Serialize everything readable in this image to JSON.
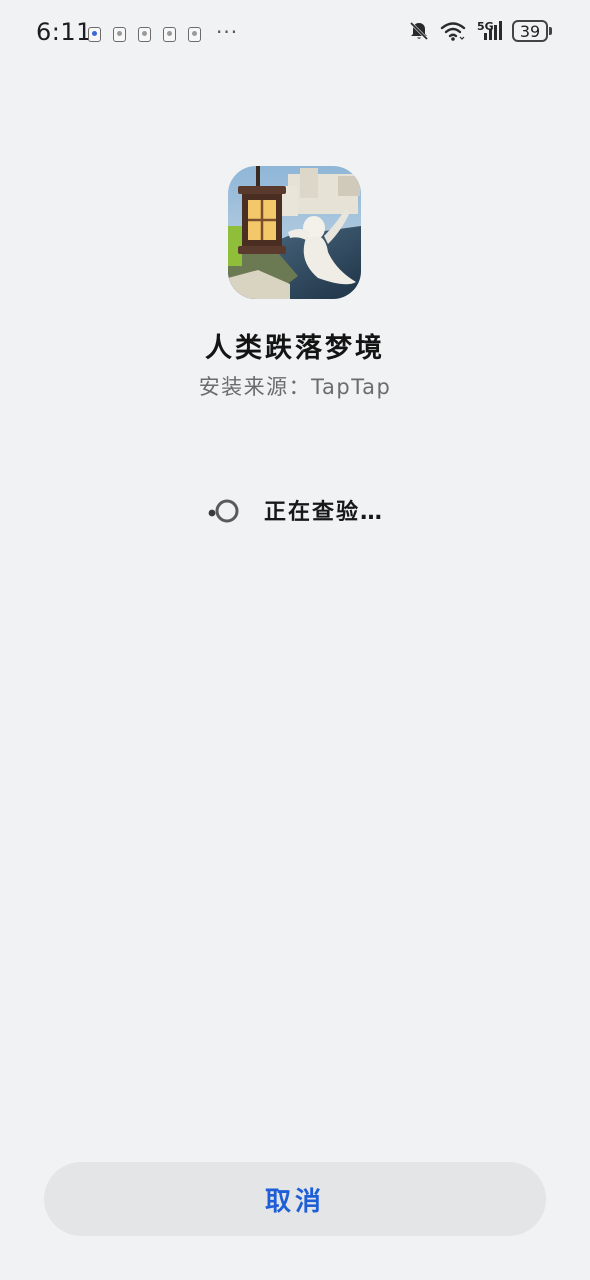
{
  "status_bar": {
    "time": "6:11",
    "more": "···",
    "network_label": "5G",
    "battery_level": "39",
    "notification_icons": [
      "notif-blue",
      "notif",
      "notif",
      "notif",
      "notif"
    ],
    "icons": [
      "mute-bell-icon",
      "wifi-icon",
      "signal-icon",
      "battery-icon"
    ]
  },
  "app": {
    "name": "人类跌落梦境",
    "install_source": "安装来源：TapTap",
    "icon": "app-icon-lantern-game"
  },
  "progress": {
    "label": "正在查验…"
  },
  "actions": {
    "cancel_label": "取消"
  },
  "colors": {
    "background": "#f0f2f4",
    "accent": "#1f5fd6",
    "button_bg": "#e3e5e7"
  }
}
